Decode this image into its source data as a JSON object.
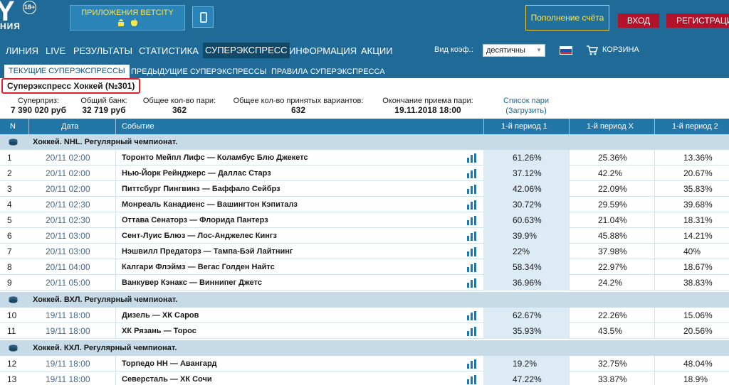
{
  "header": {
    "logo_text": "Y",
    "logo_sub": "НИЯ",
    "age_badge": "18+",
    "apps_label": "ПРИЛОЖЕНИЯ BETCITY",
    "apps_icons": "✱ ",
    "topup_label": "Пополнение счёта",
    "login_label": "ВХОД",
    "register_label": "РЕГИСТРАЦИЯ"
  },
  "nav": {
    "items": [
      "ЛИНИЯ",
      "LIVE",
      "РЕЗУЛЬТАТЫ",
      "СТАТИСТИКА",
      "СУПЕРЭКСПРЕСС",
      "ИНФОРМАЦИЯ",
      "АКЦИИ"
    ],
    "koef_label": "Вид коэф.:",
    "koef_value": "десятичны",
    "cart_label": "КОРЗИНА"
  },
  "subtabs": [
    "ТЕКУЩИЕ СУПЕРЭКСПРЕССЫ",
    "ПРЕДЫДУЩИЕ СУПЕРЭКСПРЕССЫ",
    "ПРАВИЛА СУПЕРЭКСПРЕССА"
  ],
  "express_title": "Суперэкспресс Хоккей (№301)",
  "stats": {
    "superprize_label": "Суперприз:",
    "superprize_value": "7 390 020 руб",
    "bank_label": "Общий банк:",
    "bank_value": "32 719 руб",
    "pairs_label": "Общее кол-во пари:",
    "pairs_value": "362",
    "variants_label": "Общее кол-во принятых вариантов:",
    "variants_value": "632",
    "end_label": "Окончание приема пари:",
    "end_value": "19.11.2018 18:00",
    "list_link": "Список пари",
    "load_link": "(Загрузить)"
  },
  "table": {
    "headers": [
      "N",
      "Дата",
      "Событие",
      "1-й период 1",
      "1-й период X",
      "1-й период 2"
    ],
    "groups": [
      {
        "title": "Хоккей. NHL. Регулярный чемпионат.",
        "rows": [
          {
            "n": "1",
            "date": "20/11 02:00",
            "event": "Торонто Мейпл Лифс — Коламбус Блю Джекетс",
            "p1": "61.26%",
            "px": "25.36%",
            "p2": "13.36%"
          },
          {
            "n": "2",
            "date": "20/11 02:00",
            "event": "Нью-Йорк Рейнджерс — Даллас Старз",
            "p1": "37.12%",
            "px": "42.2%",
            "p2": "20.67%"
          },
          {
            "n": "3",
            "date": "20/11 02:00",
            "event": "Питтсбург Пингвинз — Баффало Сейбрз",
            "p1": "42.06%",
            "px": "22.09%",
            "p2": "35.83%"
          },
          {
            "n": "4",
            "date": "20/11 02:30",
            "event": "Монреаль Канадиенс — Вашингтон Кэпиталз",
            "p1": "30.72%",
            "px": "29.59%",
            "p2": "39.68%"
          },
          {
            "n": "5",
            "date": "20/11 02:30",
            "event": "Оттава Сенаторз — Флорида Пантерз",
            "p1": "60.63%",
            "px": "21.04%",
            "p2": "18.31%"
          },
          {
            "n": "6",
            "date": "20/11 03:00",
            "event": "Сент-Луис Блюз — Лос-Анджелес Кингз",
            "p1": "39.9%",
            "px": "45.88%",
            "p2": "14.21%"
          },
          {
            "n": "7",
            "date": "20/11 03:00",
            "event": "Нэшвилл Предаторз — Тампа-Бэй Лайтнинг",
            "p1": "22%",
            "px": "37.98%",
            "p2": "40%"
          },
          {
            "n": "8",
            "date": "20/11 04:00",
            "event": "Калгари Флэймз — Вегас Голден Найтс",
            "p1": "58.34%",
            "px": "22.97%",
            "p2": "18.67%"
          },
          {
            "n": "9",
            "date": "20/11 05:00",
            "event": "Ванкувер Кэнакс — Виннипег Джетс",
            "p1": "36.96%",
            "px": "24.2%",
            "p2": "38.83%"
          }
        ]
      },
      {
        "title": "Хоккей. ВХЛ. Регулярный чемпионат.",
        "rows": [
          {
            "n": "10",
            "date": "19/11 18:00",
            "event": "Дизель — ХК Саров",
            "p1": "62.67%",
            "px": "22.26%",
            "p2": "15.06%"
          },
          {
            "n": "11",
            "date": "19/11 18:00",
            "event": "ХК Рязань — Торос",
            "p1": "35.93%",
            "px": "43.5%",
            "p2": "20.56%"
          }
        ]
      },
      {
        "title": "Хоккей. КХЛ. Регулярный чемпионат.",
        "rows": [
          {
            "n": "12",
            "date": "19/11 18:00",
            "event": "Торпедо НН — Авангард",
            "p1": "19.2%",
            "px": "32.75%",
            "p2": "48.04%"
          },
          {
            "n": "13",
            "date": "19/11 18:00",
            "event": "Северсталь — ХК Сочи",
            "p1": "47.22%",
            "px": "33.87%",
            "p2": "18.9%"
          }
        ]
      }
    ]
  },
  "colors": {
    "header_bg": "#1f6a97",
    "nav_active": "#11496b",
    "table_head": "#2377a8",
    "group_bg": "#c6dbe7",
    "pct_bg": "#dcebf4",
    "accent_red": "#b3132a",
    "highlight_red": "#e0202a",
    "yellow": "#ffe64a"
  },
  "icons": [
    "android-icon",
    "apple-icon",
    "phone-icon",
    "flag-ru-icon",
    "cart-icon",
    "stats-bars-icon",
    "puck-icon"
  ]
}
